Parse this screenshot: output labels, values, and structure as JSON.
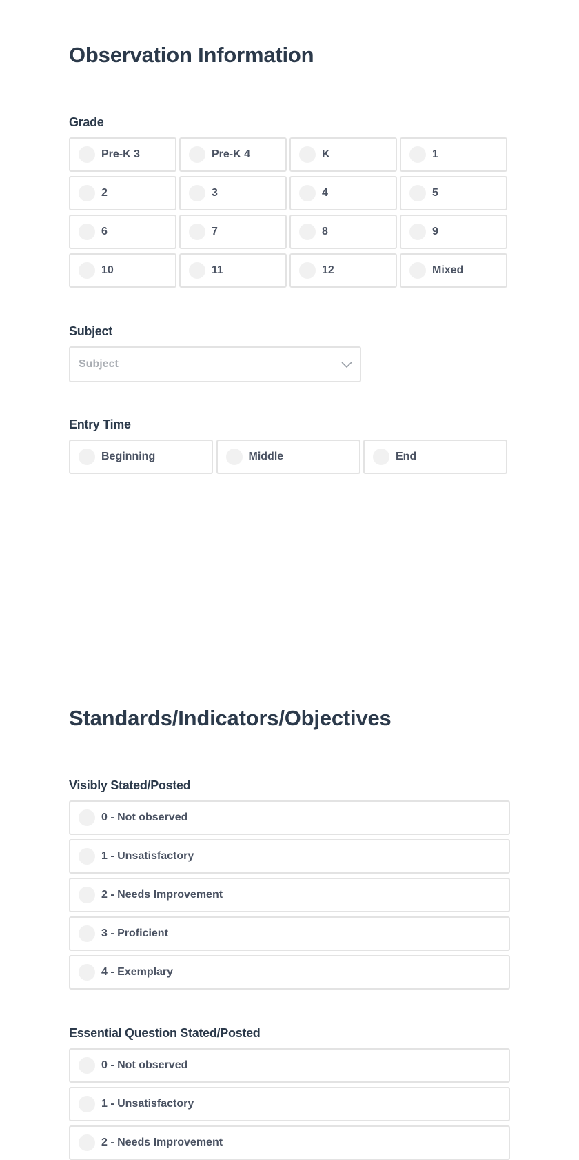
{
  "observation": {
    "title": "Observation Information",
    "grade": {
      "label": "Grade",
      "options": [
        "Pre-K 3",
        "Pre-K 4",
        "K",
        "1",
        "2",
        "3",
        "4",
        "5",
        "6",
        "7",
        "8",
        "9",
        "10",
        "11",
        "12",
        "Mixed"
      ]
    },
    "subject": {
      "label": "Subject",
      "placeholder": "Subject",
      "icon": "chevron-down-icon"
    },
    "entry_time": {
      "label": "Entry Time",
      "options": [
        "Beginning",
        "Middle",
        "End"
      ]
    }
  },
  "standards": {
    "title": "Standards/Indicators/Objectives",
    "visibly_stated": {
      "label": "Visibly Stated/Posted",
      "options": [
        "0 - Not observed",
        "1 - Unsatisfactory",
        "2 - Needs Improvement",
        "3 - Proficient",
        "4 - Exemplary"
      ]
    },
    "essential_question": {
      "label": "Essential Question Stated/Posted",
      "options": [
        "0 - Not observed",
        "1 - Unsatisfactory",
        "2 - Needs Improvement"
      ]
    }
  }
}
